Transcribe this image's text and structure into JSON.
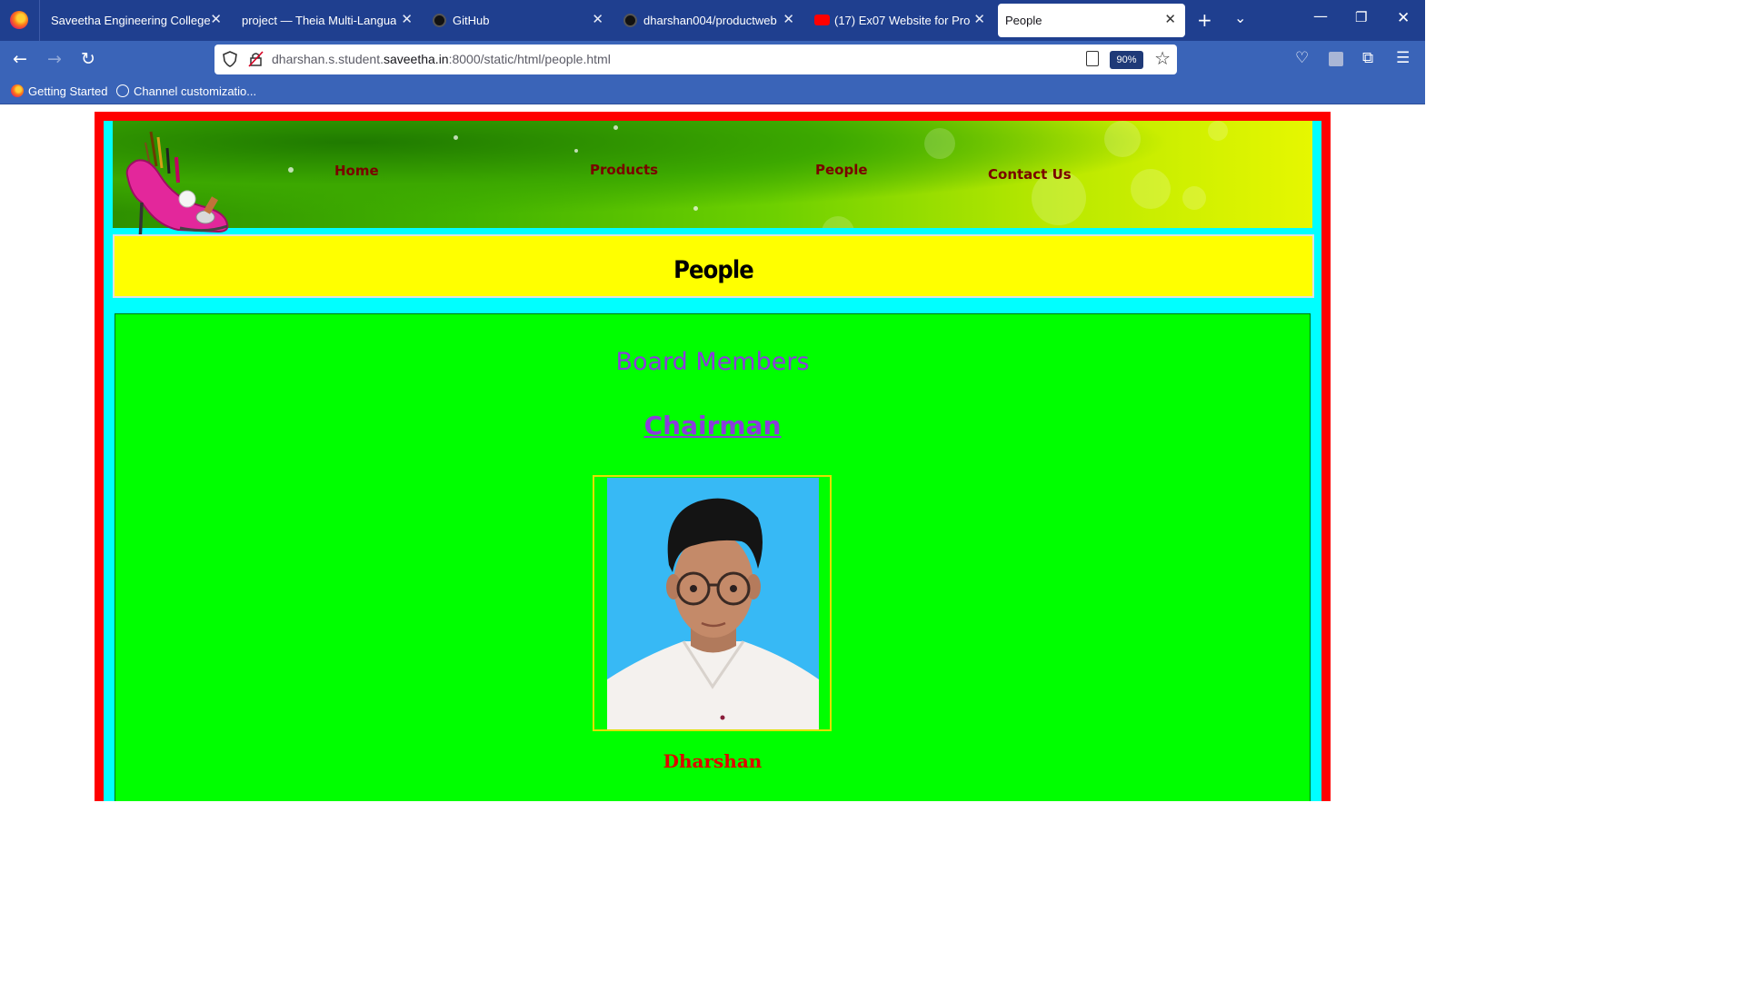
{
  "browser": {
    "tabs": [
      {
        "title": "Saveetha Engineering College",
        "active": false
      },
      {
        "title": "project — Theia Multi-Language",
        "active": false
      },
      {
        "title": "GitHub",
        "active": false
      },
      {
        "title": "dharshan004/productweb",
        "active": false
      },
      {
        "title": "(17) Ex07 Website for Produ",
        "active": false
      },
      {
        "title": "People",
        "active": true
      }
    ],
    "url_prefix": "dharshan.s.student.",
    "url_domain": "saveetha.in",
    "url_suffix": ":8000/static/html/people.html",
    "zoom": "90%",
    "bookmarks": [
      {
        "label": "Getting Started"
      },
      {
        "label": "Channel customizatio..."
      }
    ]
  },
  "site": {
    "nav": {
      "home": "Home",
      "products": "Products",
      "people": "People",
      "contact": "Contact Us"
    },
    "page_title": "People",
    "section_heading": "Board Members",
    "role_heading": "Chairman",
    "member_name": "Dharshan"
  },
  "colors": {
    "outer_border": "#ff0000",
    "inner_border": "#00ffff",
    "title_bg": "#ffff00",
    "content_bg": "#00ff00",
    "heading_color": "#8b3cdc",
    "name_color": "#e00000",
    "nav_color": "#7a0000"
  }
}
